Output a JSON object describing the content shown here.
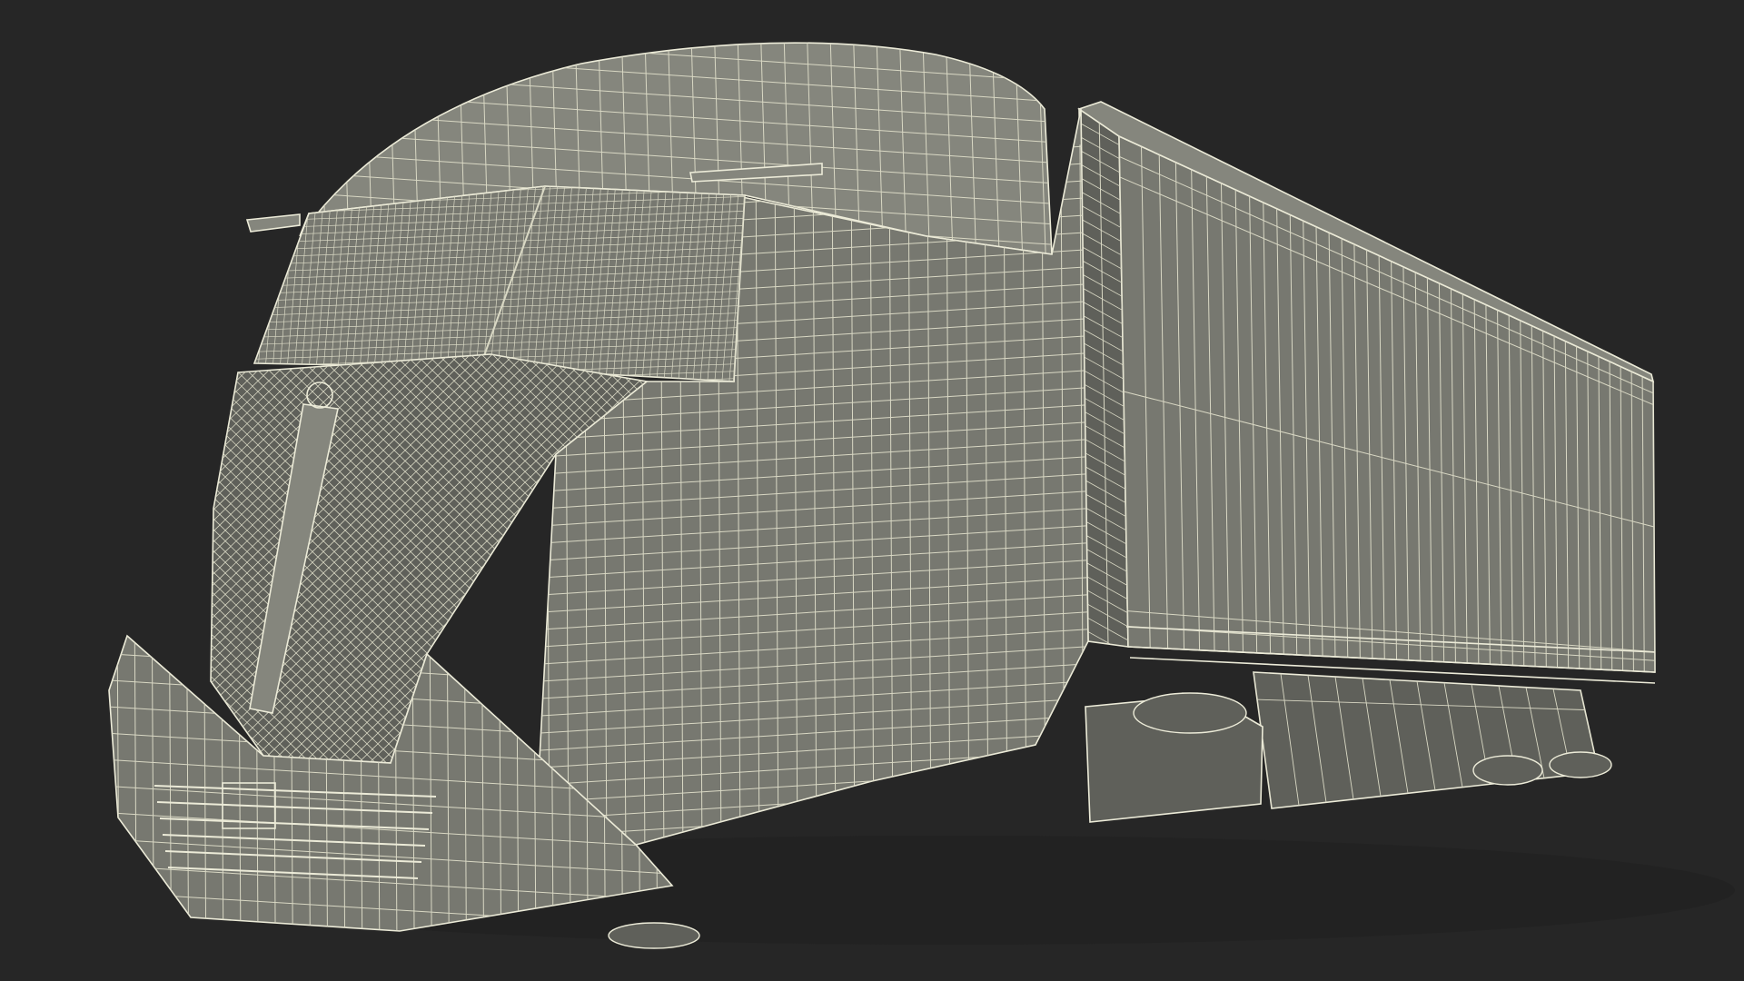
{
  "scene": {
    "subject_icon": "semi-truck-wireframe-icon",
    "colors": {
      "background": "#262626",
      "surface": "#777870",
      "surface_light": "#85867d",
      "surface_dark": "#5f605a",
      "wire": "#ecebd8",
      "wire_dim": "#d9d8c4",
      "shadow": "#1e1e1e"
    }
  }
}
